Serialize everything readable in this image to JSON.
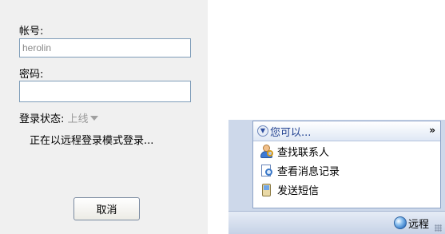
{
  "login": {
    "account_label": "帐号:",
    "account_value": "herolin",
    "password_label": "密码:",
    "password_value": "",
    "status_label": "登录状态:",
    "status_value": "上线",
    "progress_text": "正在以远程登录模式登录...",
    "cancel_label": "取消"
  },
  "menu": {
    "header_label": "您可以...",
    "expand_glyph": "»",
    "items": [
      {
        "label": "查找联系人",
        "icon": "find-contact-icon"
      },
      {
        "label": "查看消息记录",
        "icon": "message-history-icon"
      },
      {
        "label": "发送短信",
        "icon": "send-sms-icon"
      }
    ]
  },
  "taskbar": {
    "remote_label": "远程",
    "remote_icon": "globe-icon"
  },
  "colors": {
    "panel_bg": "#f0f0f0",
    "menu_header_text": "#1f3f8f",
    "input_border": "#7f9db9",
    "taskbar_bg": "#cdd8ea"
  }
}
